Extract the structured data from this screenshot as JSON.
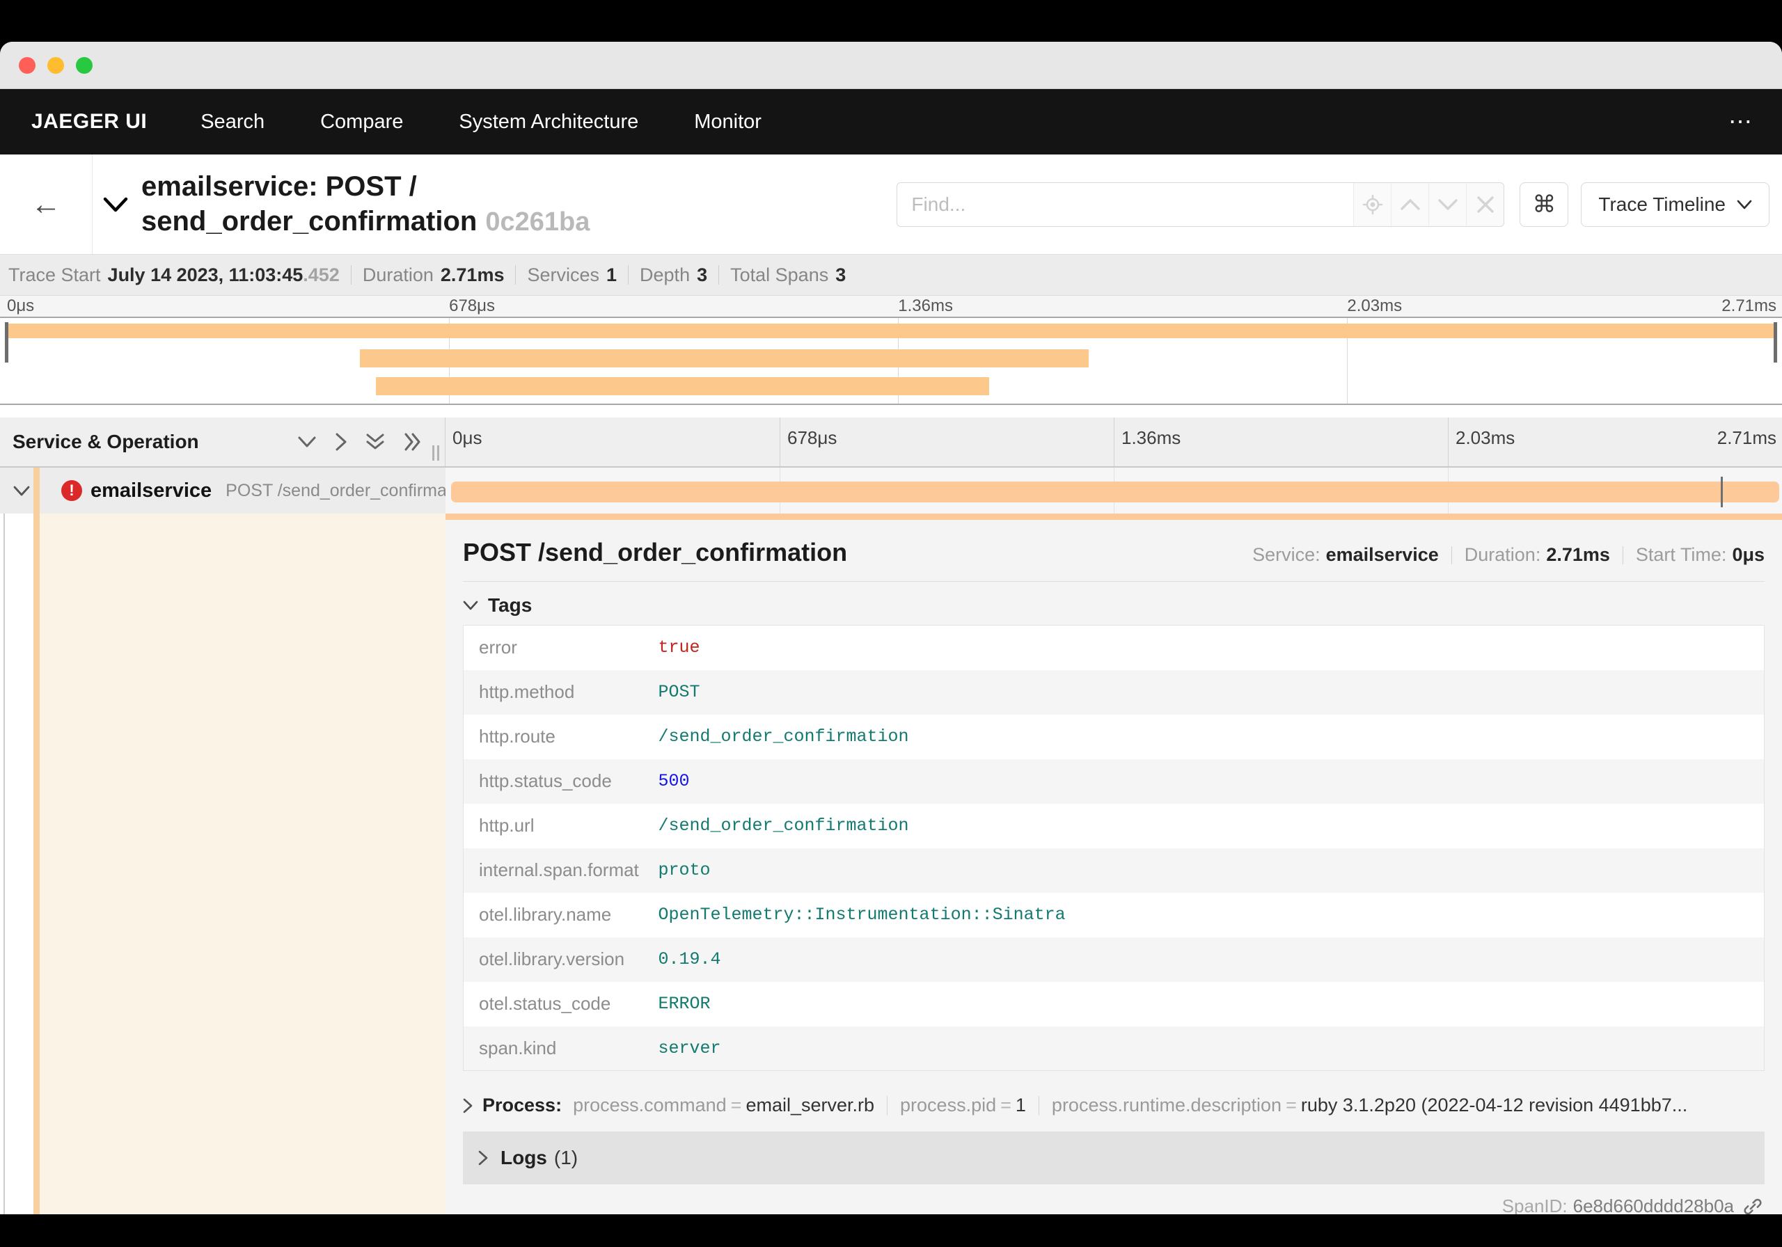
{
  "nav": {
    "brand": "JAEGER UI",
    "items": [
      "Search",
      "Compare",
      "System Architecture",
      "Monitor"
    ],
    "overflow": "⋯"
  },
  "header": {
    "back": "←",
    "title_line1": "emailservice: POST /",
    "title_line2": "send_order_confirmation",
    "trace_id": "0c261ba",
    "find_placeholder": "Find...",
    "shortcut_key": "⌘",
    "view_mode": "Trace Timeline"
  },
  "summary": {
    "trace_start_label": "Trace Start",
    "trace_start_value": "July 14 2023, 11:03:45",
    "trace_start_ms": ".452",
    "duration_label": "Duration",
    "duration_value": "2.71ms",
    "services_label": "Services",
    "services_value": "1",
    "depth_label": "Depth",
    "depth_value": "3",
    "total_spans_label": "Total Spans",
    "total_spans_value": "3"
  },
  "timeline": {
    "ticks": [
      "0μs",
      "678μs",
      "1.36ms",
      "2.03ms",
      "2.71ms"
    ]
  },
  "minimap": {
    "bars": [
      {
        "left": 0.3,
        "width": 99.4
      },
      {
        "left": 20.2,
        "width": 40.9
      },
      {
        "left": 21.1,
        "width": 34.4
      }
    ]
  },
  "grid_header": {
    "label": "Service & Operation"
  },
  "span": {
    "service": "emailservice",
    "operation": "POST /send_order_confirmation",
    "bar": {
      "left": 0.4,
      "width": 99.4
    },
    "log_marker": {
      "left": 95.4
    }
  },
  "detail": {
    "title": "POST /send_order_confirmation",
    "service_label": "Service:",
    "service_value": "emailservice",
    "duration_label": "Duration:",
    "duration_value": "2.71ms",
    "start_label": "Start Time:",
    "start_value": "0μs",
    "tags_label": "Tags",
    "tags": [
      {
        "key": "error",
        "value": "true",
        "type": "bool"
      },
      {
        "key": "http.method",
        "value": "POST",
        "type": "string"
      },
      {
        "key": "http.route",
        "value": "/send_order_confirmation",
        "type": "string"
      },
      {
        "key": "http.status_code",
        "value": "500",
        "type": "number"
      },
      {
        "key": "http.url",
        "value": "/send_order_confirmation",
        "type": "string"
      },
      {
        "key": "internal.span.format",
        "value": "proto",
        "type": "string"
      },
      {
        "key": "otel.library.name",
        "value": "OpenTelemetry::Instrumentation::Sinatra",
        "type": "string"
      },
      {
        "key": "otel.library.version",
        "value": "0.19.4",
        "type": "string"
      },
      {
        "key": "otel.status_code",
        "value": "ERROR",
        "type": "string"
      },
      {
        "key": "span.kind",
        "value": "server",
        "type": "string"
      }
    ],
    "process_label": "Process:",
    "process": [
      {
        "key": "process.command",
        "value": "email_server.rb"
      },
      {
        "key": "process.pid",
        "value": "1"
      },
      {
        "key": "process.runtime.description",
        "value": "ruby 3.1.2p20 (2022-04-12 revision 4491bb7..."
      }
    ],
    "logs_label": "Logs",
    "logs_count": "(1)",
    "spanid_label": "SpanID:",
    "spanid_value": "6e8d660dddd28b0a"
  },
  "colors": {
    "accent_orange": "#fec998",
    "error_red": "#db2828",
    "tag_string": "#127a6e",
    "tag_number": "#1414e8",
    "tag_bool": "#bf251d",
    "nav_bg": "#141414"
  }
}
